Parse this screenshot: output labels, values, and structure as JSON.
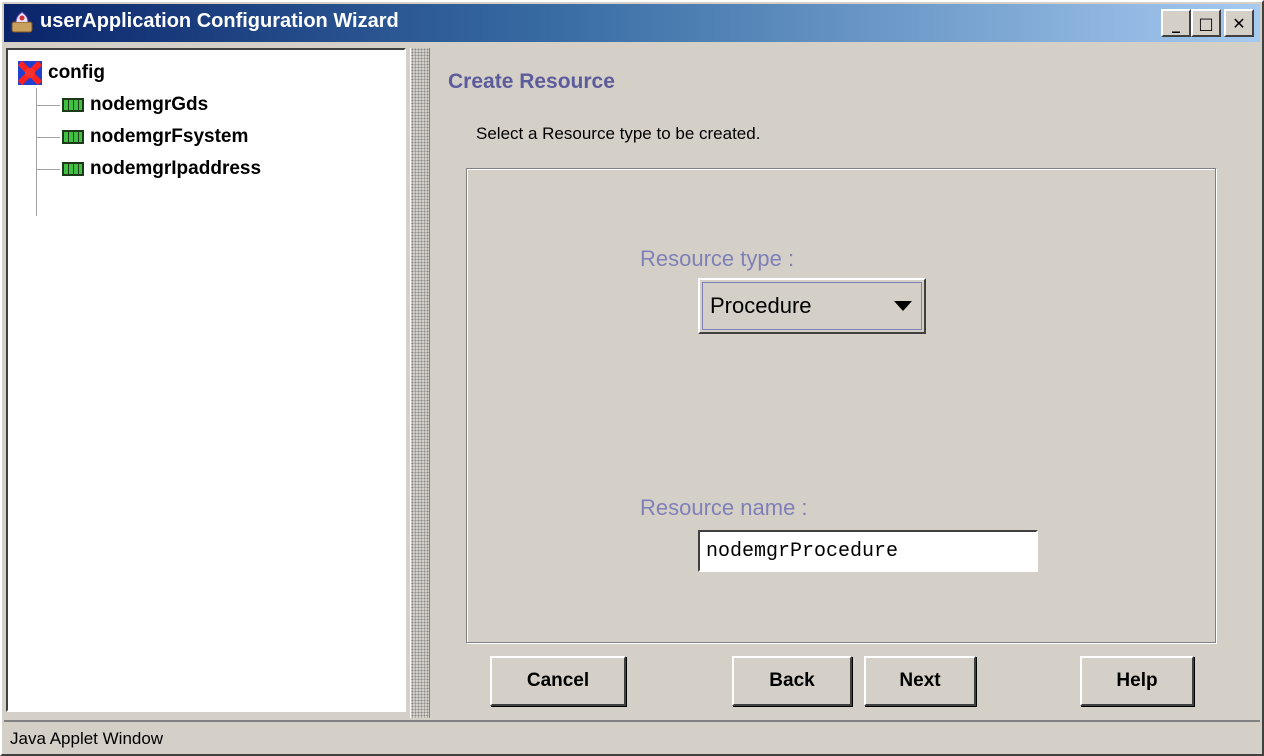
{
  "window": {
    "title": "userApplication Configuration Wizard",
    "minimize_glyph": "_",
    "maximize_glyph": "□",
    "close_glyph": "✕"
  },
  "tree": {
    "root": {
      "label": "config",
      "icon": "config-icon"
    },
    "items": [
      {
        "label": "nodemgrGds",
        "icon": "resource-icon"
      },
      {
        "label": "nodemgrFsystem",
        "icon": "resource-icon"
      },
      {
        "label": "nodemgrIpaddress",
        "icon": "resource-icon"
      }
    ]
  },
  "content": {
    "title": "Create Resource",
    "description": "Select a Resource type to be created.",
    "resource_type_label": "Resource type   :",
    "resource_type_value": "Procedure",
    "resource_name_label": "Resource name   :",
    "resource_name_value": "nodemgrProcedure"
  },
  "buttons": {
    "cancel": "Cancel",
    "back": "Back",
    "next": "Next",
    "help": "Help"
  },
  "status": {
    "text": "Java Applet Window"
  },
  "colors": {
    "title_gradient_start": "#0a246a",
    "title_gradient_end": "#a6caf0",
    "heading": "#5c5c9c",
    "field_label": "#8080b8",
    "panel_bg": "#d4d0c8"
  }
}
